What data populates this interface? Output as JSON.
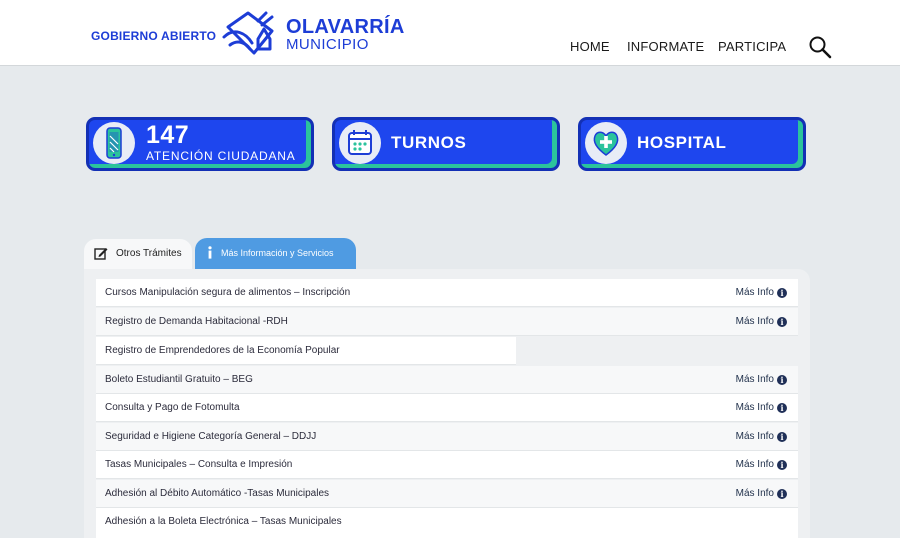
{
  "header": {
    "gobierno": "GOBIERNO ABIERTO",
    "brand_main": "OLAVARRÍA",
    "brand_sub": "MUNICIPIO",
    "nav": [
      "HOME",
      "INFORMATE",
      "PARTICIPA"
    ]
  },
  "cards": {
    "c1_number": "147",
    "c1_label": "ATENCIÓN CIUDADANA",
    "c2_label": "TURNOS",
    "c3_label": "HOSPITAL"
  },
  "tabs": {
    "tab1": "Otros Trámites",
    "tab2": "Más Información y Servicios"
  },
  "list": {
    "more_label": "Más Info",
    "info_glyph": "i",
    "items": [
      "Cursos Manipulación segura de alimentos – Inscripción",
      "Registro de Demanda Habitacional -RDH",
      "Registro de Emprendedores de la Economía Popular",
      "Boleto Estudiantil Gratuito – BEG",
      "Consulta y Pago de Fotomulta",
      "Seguridad e Higiene Categoría General – DDJJ",
      "Tasas Municipales – Consulta e Impresión",
      "Adhesión al Débito Automático -Tasas Municipales",
      "Adhesión a la Boleta Electrónica – Tasas Municipales"
    ]
  },
  "colors": {
    "brand_blue": "#1d3dd6",
    "card_blue": "#1e46ee",
    "card_accent": "#2bc39c",
    "tab_blue": "#4f9be2"
  },
  "icons": [
    "logo-mark",
    "search-icon",
    "phone-icon",
    "calendar-icon",
    "heart-cross-icon",
    "edit-icon",
    "info-icon"
  ]
}
